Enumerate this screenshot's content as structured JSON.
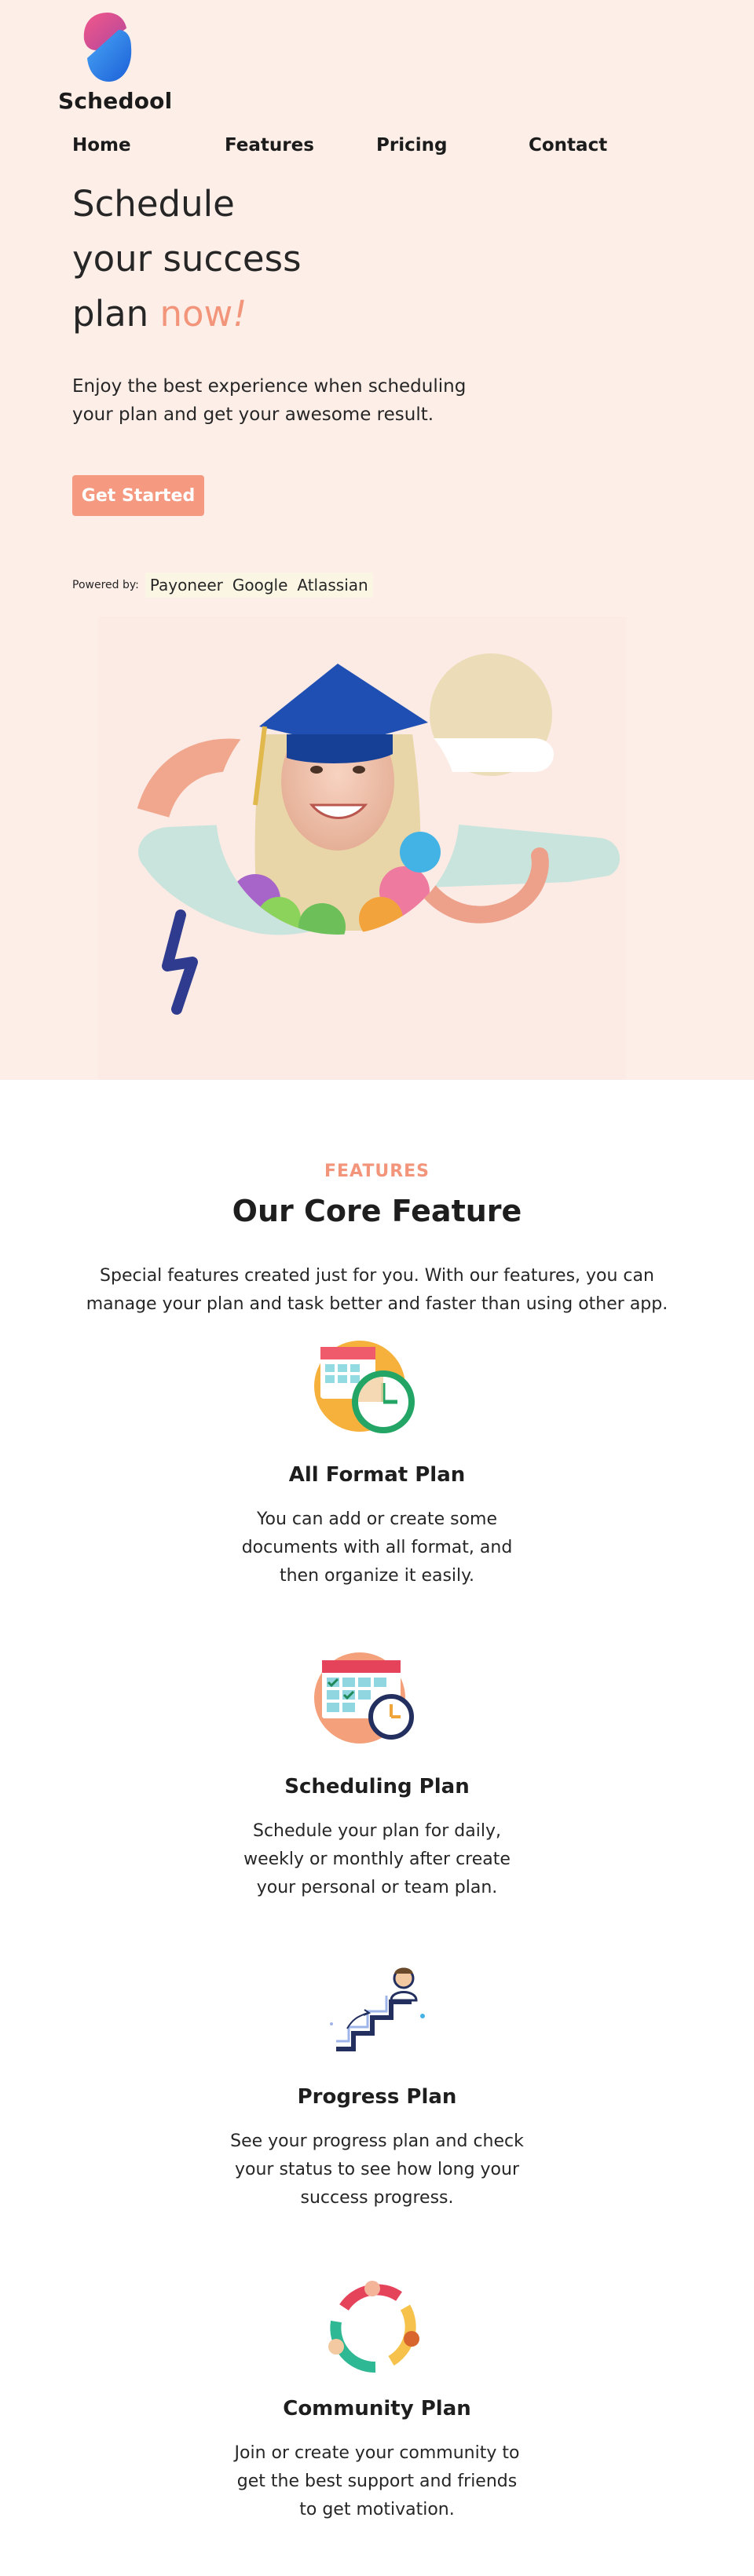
{
  "brand": {
    "name": "Schedool"
  },
  "nav": {
    "items": [
      "Home",
      "Features",
      "Pricing",
      "Contact"
    ]
  },
  "hero": {
    "headline_line1": "Schedule",
    "headline_line2": "your success",
    "headline_line3_plain": "plan",
    "headline_line3_accent": "now",
    "headline_bang": "!",
    "subtext": "Enjoy the best experience when scheduling your plan and get your awesome result.",
    "cta_label": "Get Started",
    "powered_label": "Powered by:",
    "partners": [
      "Payoneer",
      "Google",
      "Atlassian"
    ]
  },
  "features": {
    "eyebrow": "FEATURES",
    "title": "Our Core Feature",
    "description": "Special features created just for you. With our features, you can manage your plan and task better and faster than using other app.",
    "cards": [
      {
        "title": "All Format Plan",
        "text": "You can add or create some documents with all format, and then organize it easily.",
        "icon": "calendar-clock-icon"
      },
      {
        "title": "Scheduling Plan",
        "text": "Schedule your plan for daily, weekly or monthly after create your personal or team plan.",
        "icon": "schedule-calendar-icon"
      },
      {
        "title": "Progress Plan",
        "text": "See your progress plan and check your status to see how long your success progress.",
        "icon": "progress-stairs-icon"
      },
      {
        "title": "Community Plan",
        "text": "Join or create your community to get the best support and friends to get motivation.",
        "icon": "community-circle-icon"
      }
    ]
  },
  "colors": {
    "hero_bg": "#fdeee8",
    "accent": "#f2957b",
    "cta": "#f59a80",
    "text": "#1e1e1e"
  }
}
